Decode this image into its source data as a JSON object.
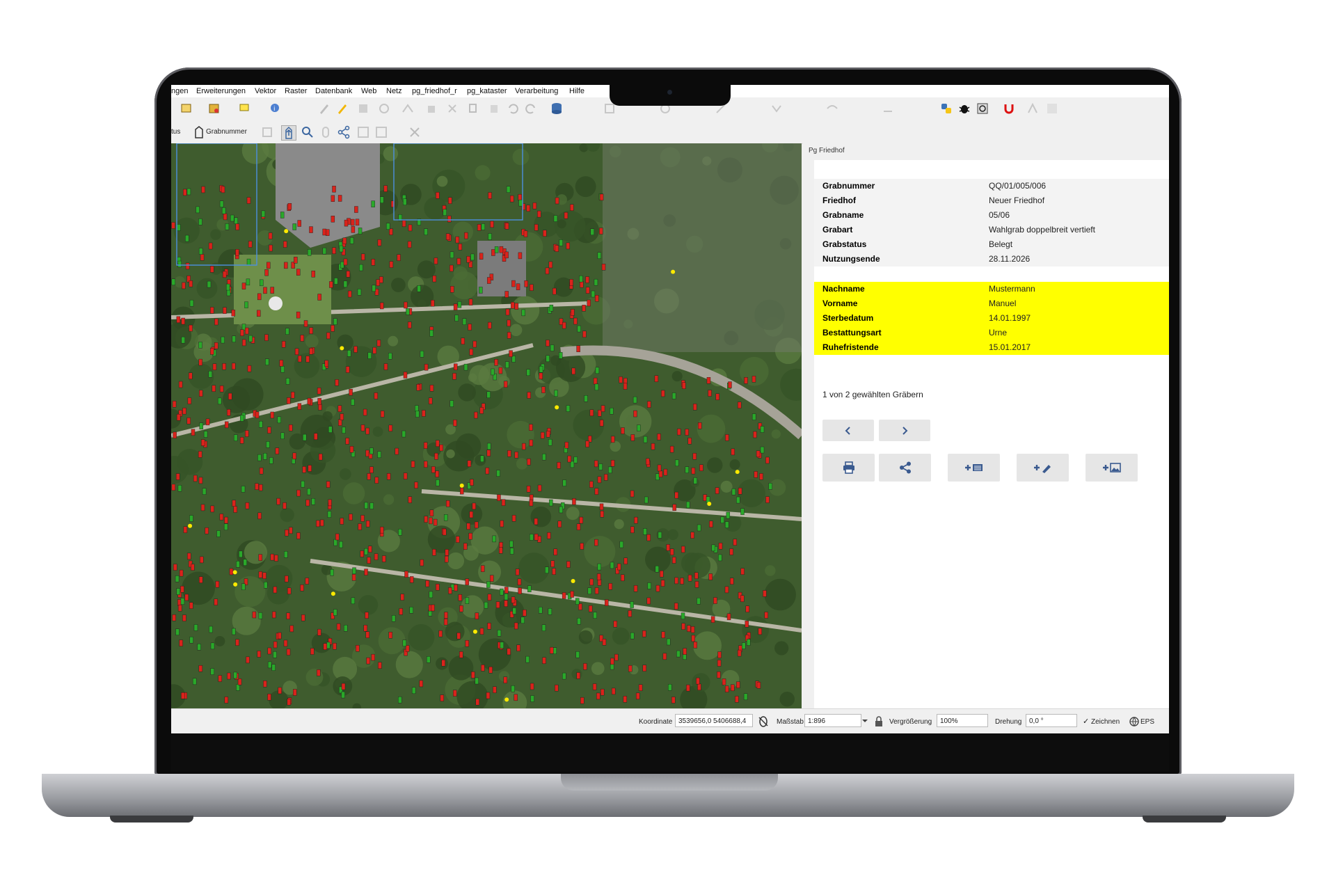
{
  "menu": [
    "ngen",
    "Erweiterungen",
    "Vektor",
    "Raster",
    "Datenbank",
    "Web",
    "Netz",
    "pg_friedhof_r",
    "pg_kataster",
    "Verarbeitung",
    "Hilfe"
  ],
  "toolbar2": {
    "status_label": "tus",
    "grabnummer_label": "Grabnummer"
  },
  "panel": {
    "title": "Pg Friedhof",
    "grave": [
      {
        "key": "Grabnummer",
        "value": "QQ/01/005/006"
      },
      {
        "key": "Friedhof",
        "value": "Neuer Friedhof"
      },
      {
        "key": "Grabname",
        "value": "05/06"
      },
      {
        "key": "Grabart",
        "value": "Wahlgrab doppelbreit vertieft"
      },
      {
        "key": "Grabstatus",
        "value": "Belegt"
      },
      {
        "key": "Nutzungsende",
        "value": "28.11.2026"
      }
    ],
    "person": [
      {
        "key": "Nachname",
        "value": "Mustermann"
      },
      {
        "key": "Vorname",
        "value": "Manuel"
      },
      {
        "key": "Sterbedatum",
        "value": "14.01.1997"
      },
      {
        "key": "Bestattungsart",
        "value": "Urne"
      },
      {
        "key": "Ruhefristende",
        "value": "15.01.2017"
      }
    ],
    "selection_info": "1 von 2 gewählten Gräbern",
    "highlight_color": "#ffff00"
  },
  "statusbar": {
    "coord_label": "Koordinate",
    "coord_value": "3539656,0 5406688,4",
    "scale_label": "Maßstab",
    "scale_value": "1:896",
    "zoom_label": "Vergrößerung",
    "zoom_value": "100%",
    "rotation_label": "Drehung",
    "rotation_value": "0,0 °",
    "render_label": "Zeichnen",
    "crs_label": "EPS"
  },
  "icons": [
    "save-icon",
    "print-icon",
    "share-icon",
    "add-list-icon",
    "add-edit-icon",
    "add-image-icon",
    "chevron-left-icon",
    "chevron-right-icon",
    "lock-icon",
    "python-icon",
    "bug-icon",
    "magnet-icon",
    "database-icon",
    "identify-icon",
    "pencil-icon",
    "zoom-icon",
    "select-icon"
  ]
}
